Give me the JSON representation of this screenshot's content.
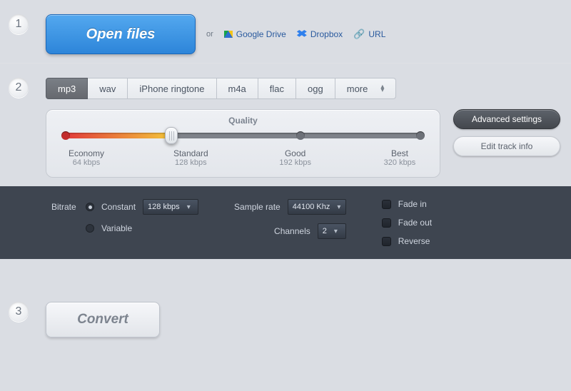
{
  "step_labels": {
    "s1": "1",
    "s2": "2",
    "s3": "3"
  },
  "open": {
    "button": "Open files",
    "or": "or",
    "gdrive": "Google Drive",
    "dropbox": "Dropbox",
    "url": "URL"
  },
  "tabs": {
    "t0": "mp3",
    "t1": "wav",
    "t2": "iPhone ringtone",
    "t3": "m4a",
    "t4": "flac",
    "t5": "ogg",
    "t6": "more"
  },
  "quality": {
    "title": "Quality",
    "economy_label": "Economy",
    "economy_val": "64 kbps",
    "standard_label": "Standard",
    "standard_val": "128 kbps",
    "good_label": "Good",
    "good_val": "192 kbps",
    "best_label": "Best",
    "best_val": "320 kbps"
  },
  "side": {
    "advanced": "Advanced settings",
    "edit_info": "Edit track info"
  },
  "adv": {
    "bitrate_label": "Bitrate",
    "constant": "Constant",
    "variable": "Variable",
    "bitrate_value": "128 kbps",
    "sample_rate_label": "Sample rate",
    "sample_rate_value": "44100 Khz",
    "channels_label": "Channels",
    "channels_value": "2",
    "fade_in": "Fade in",
    "fade_out": "Fade out",
    "reverse": "Reverse"
  },
  "convert": "Convert"
}
